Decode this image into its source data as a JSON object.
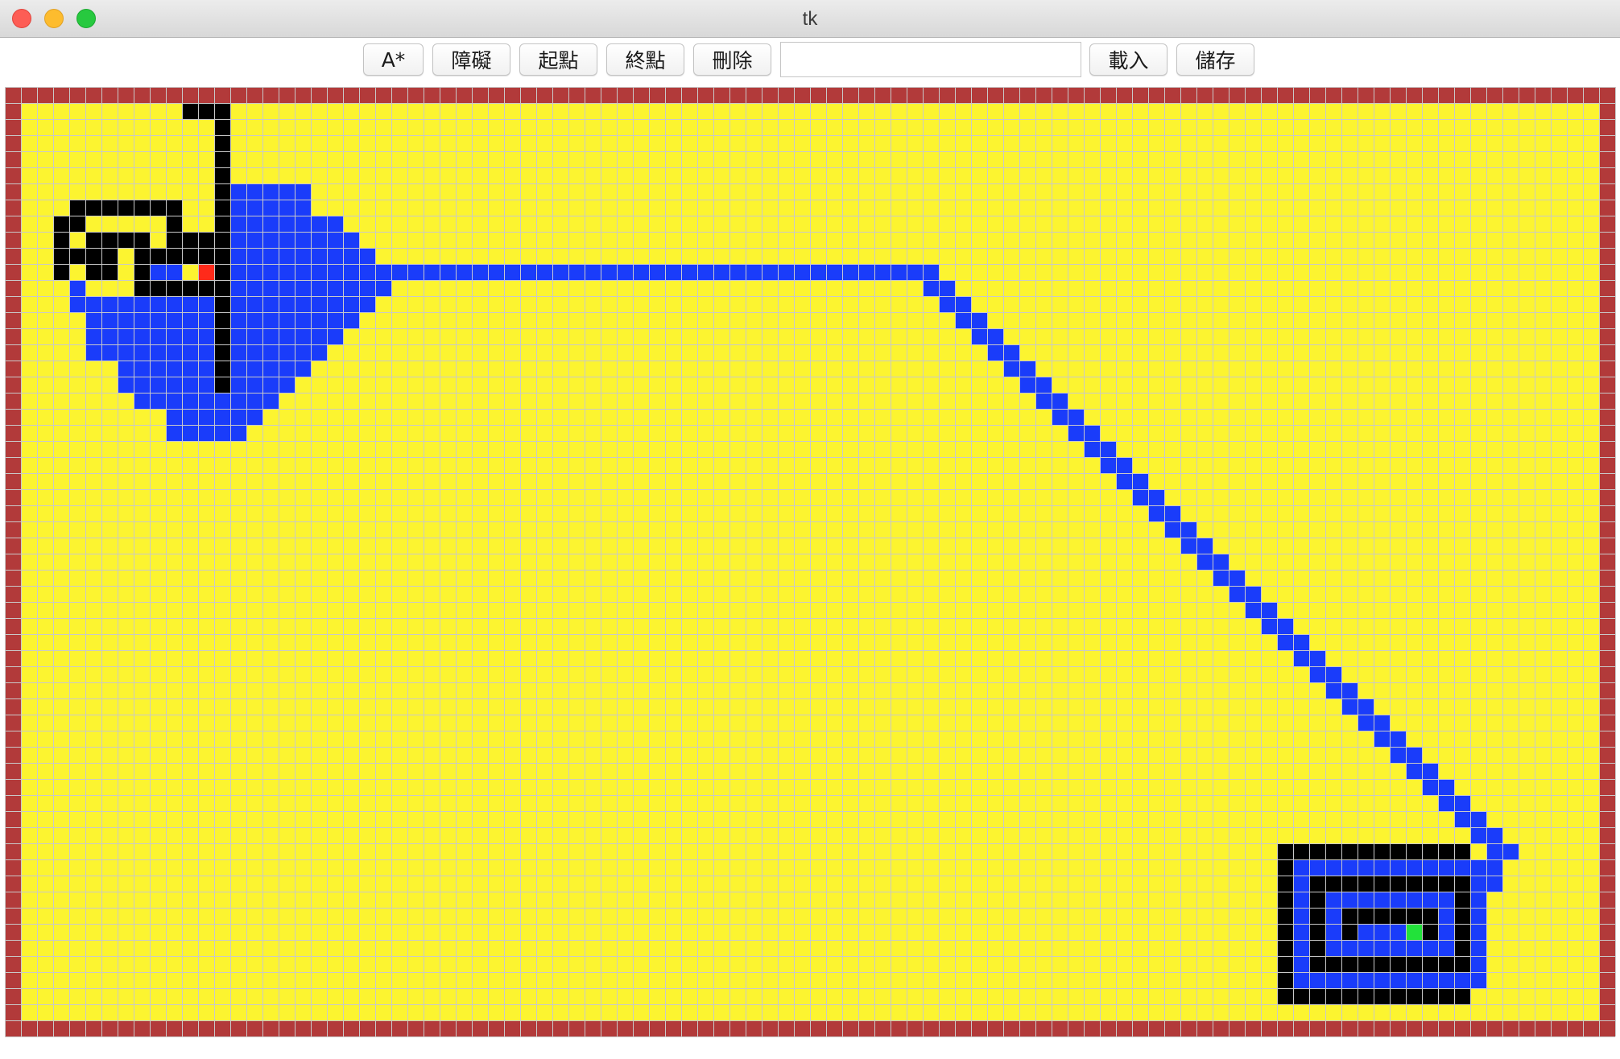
{
  "window": {
    "title": "tk"
  },
  "toolbar": {
    "buttons": [
      {
        "id": "astar",
        "label": "A*"
      },
      {
        "id": "obstacle",
        "label": "障礙"
      },
      {
        "id": "start",
        "label": "起點"
      },
      {
        "id": "end",
        "label": "終點"
      },
      {
        "id": "delete",
        "label": "刪除"
      },
      {
        "id": "load",
        "label": "載入"
      },
      {
        "id": "save",
        "label": "儲存"
      }
    ],
    "file_input": {
      "value": "",
      "placeholder": ""
    }
  },
  "grid": {
    "cols": 100,
    "rows": 59,
    "colors": {
      "empty": "#fcf430",
      "border": "#b23a3a",
      "obstacle": "#000000",
      "explored": "#1a3cfa",
      "start": "#ff2a1a",
      "end": "#22e23a",
      "gridline": "#c9c9c9"
    },
    "start_cell": [
      12,
      11
    ],
    "end_cell": [
      87,
      52
    ]
  }
}
